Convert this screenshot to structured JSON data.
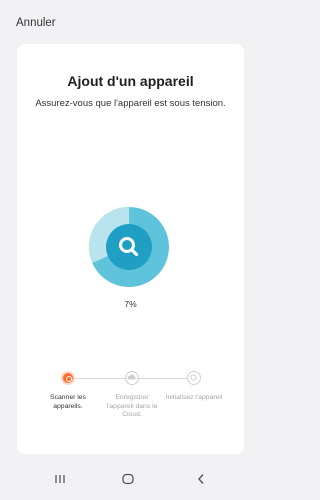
{
  "header": {
    "cancel_label": "Annuler"
  },
  "main": {
    "title": "Ajout d'un appareil",
    "subtitle": "Assurez-vous que l'appareil est sous tension.",
    "progress": {
      "value_percent": 7,
      "label": "7%"
    }
  },
  "steps": [
    {
      "label": "Scanner les appareils.",
      "state": "active"
    },
    {
      "label": "Enregistrer l'appareil dans le Cloud.",
      "state": "inactive"
    },
    {
      "label": "Initialisez l'appareil",
      "state": "inactive"
    }
  ],
  "colors": {
    "accent": "#ff6b2c",
    "scan_ring": "#5fc3dc",
    "scan_core": "#1f9fc4",
    "inactive": "#cfcfcf"
  },
  "icons": {
    "scan": "search-icon",
    "nav": [
      "recent-apps-icon",
      "home-icon",
      "back-icon"
    ]
  }
}
